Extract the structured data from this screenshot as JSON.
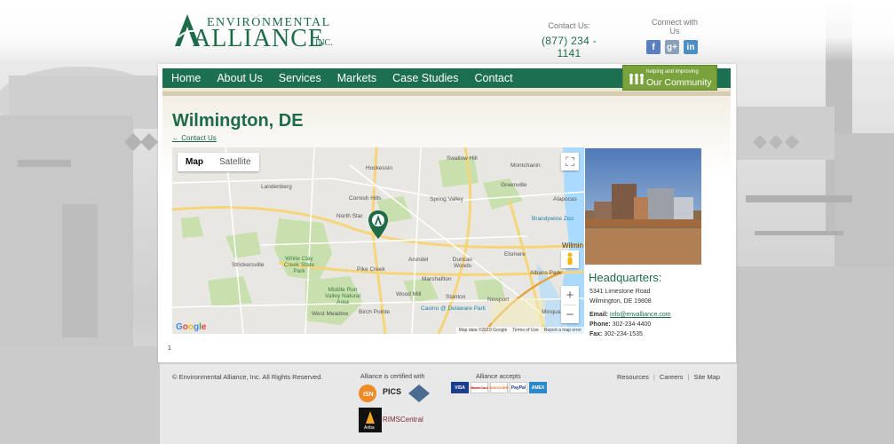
{
  "brand": {
    "logo_top": "ENVIRONMENTAL",
    "logo_big": "ALLIANCE",
    "logo_inc": "INC."
  },
  "header": {
    "contact_label": "Contact Us:",
    "contact_phone": "(877) 234 - 1141",
    "social_label": "Connect with Us",
    "social_icons": [
      "facebook-icon",
      "google-plus-icon",
      "linkedin-icon"
    ]
  },
  "nav": {
    "items": [
      "Home",
      "About Us",
      "Services",
      "Markets",
      "Case Studies",
      "Contact"
    ]
  },
  "community": {
    "small": "helping and improving",
    "big": "Our Community"
  },
  "page": {
    "title": "Wilmington, DE",
    "back_link": "← Contact Us",
    "page_number": "1"
  },
  "map": {
    "tabs": [
      "Map",
      "Satellite"
    ],
    "active_tab": "Map",
    "places": [
      "Hockessin",
      "Swallow Hill",
      "Montchanin",
      "Landenberg",
      "Cornish Hills",
      "Greenville",
      "Alapocas",
      "North Star",
      "Spring Valley",
      "Brandywine Zoo",
      "Wilmin",
      "Strickersville",
      "White Clay Creek State Park",
      "Pike Creek",
      "Arundel",
      "Duncan Woods",
      "Elsmere",
      "Albans Park",
      "Marshallton",
      "Middle Run Valley Natural Area",
      "Wood Mill",
      "Stanton",
      "Newport",
      "Minqua",
      "West Meadow",
      "Birch Pointe",
      "Casino @ Delaware Park"
    ],
    "footer": [
      "Map data ©2019 Google",
      "Terms of Use",
      "Report a map error"
    ],
    "google_logo": "Google"
  },
  "hq": {
    "title": "Headquarters:",
    "address_line1": "5341 Limestone Road",
    "address_line2": "Wilmington, DE 19808",
    "email_label": "Email:",
    "email": "info@envalliance.com",
    "phone_label": "Phone:",
    "phone": "302-234-4400",
    "fax_label": "Fax:",
    "fax": "302-234-1535"
  },
  "footer": {
    "copyright": "© Environmental Alliance, Inc. All Rights Reserved.",
    "certified_label": "Alliance is certified with",
    "accepts_label": "Alliance accepts",
    "cert_logos": [
      "ISN",
      "PICS",
      "RIMSCentral",
      "Ariba"
    ],
    "cards": [
      "VISA",
      "MasterCard",
      "DISCOVER",
      "PayPal",
      "AMEX"
    ],
    "links": [
      "Resources",
      "Careers",
      "Site Map"
    ]
  },
  "colors": {
    "brand_green": "#1d6f52",
    "community_green": "#7aa23c"
  }
}
